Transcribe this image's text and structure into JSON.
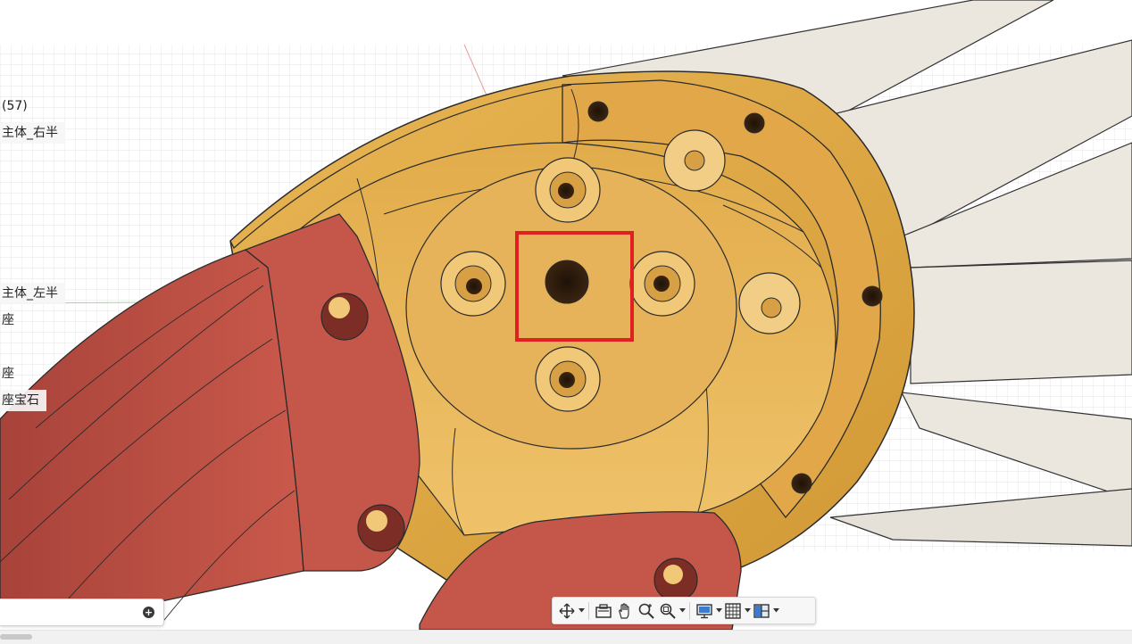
{
  "browser": {
    "items": [
      {
        "text": "(57)",
        "style": "plain"
      },
      {
        "text": "主体_右半",
        "style": "label"
      },
      {
        "text": "主体_左半",
        "style": "label"
      },
      {
        "text": "座",
        "style": "plain"
      },
      {
        "text": "座",
        "style": "plain"
      },
      {
        "text": "座宝石",
        "style": "label"
      }
    ]
  },
  "timeline": {
    "add_icon": "plus-circle-icon"
  },
  "toolbar": {
    "icons": [
      "orbit-icon",
      "look-at-icon",
      "pan-icon",
      "zoom-icon",
      "fit-icon",
      "display-settings-icon",
      "grid-settings-icon",
      "viewports-icon"
    ]
  },
  "colors": {
    "body_orange": "#dba246",
    "body_orange_dark": "#b98629",
    "cone_red": "#c25347",
    "blade": "#e8e2d8",
    "grid": "#d9d9d9",
    "highlight_box": "#e02020"
  }
}
